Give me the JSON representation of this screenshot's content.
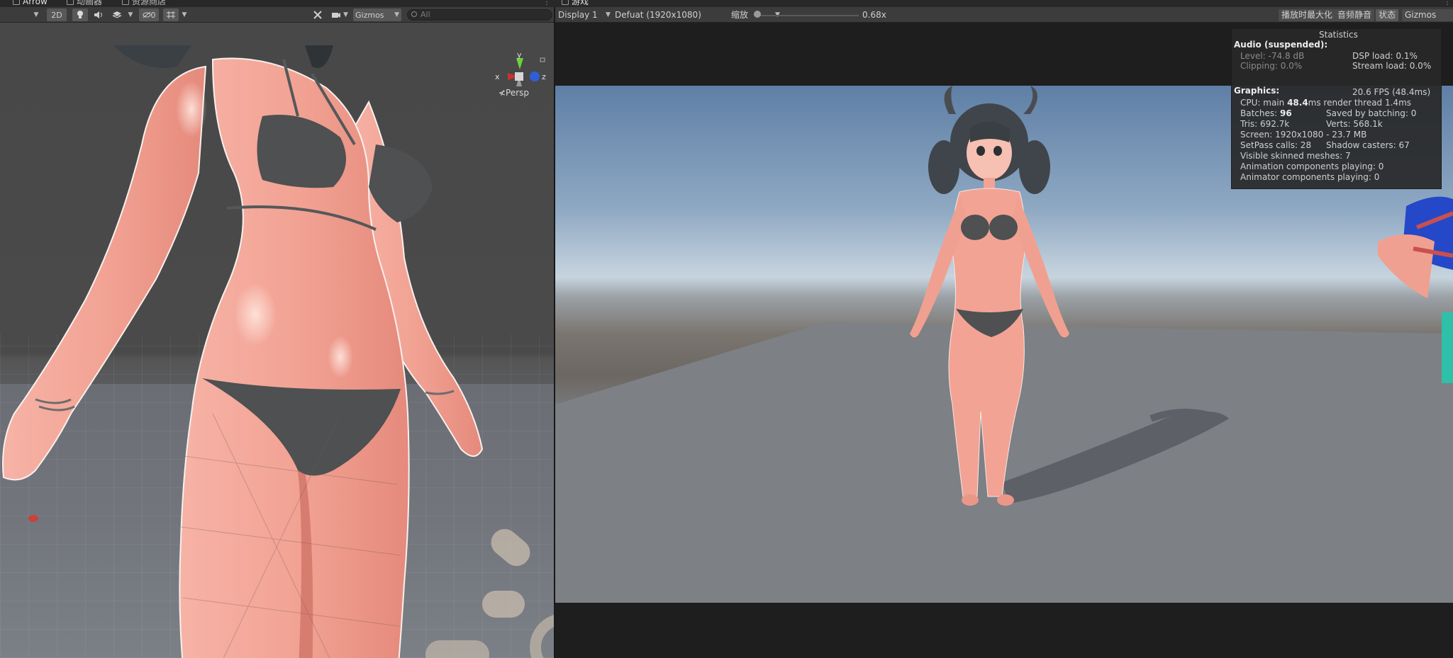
{
  "tabs": {
    "scene_tab_arrow": "Arrow",
    "animator_tab": "动画器",
    "asset_store_tab": "资源商店",
    "game_tab": "游戏"
  },
  "scene_toolbar": {
    "mode_2d": "2D",
    "hidden_count": "0",
    "gizmos_label": "Gizmos",
    "search_placeholder": "All"
  },
  "scene_view": {
    "axis_x": "x",
    "axis_y": "y",
    "axis_z": "z",
    "persp_label": "≮Persp"
  },
  "game_toolbar": {
    "display": "Display 1",
    "resolution": "Defuat (1920x1080)",
    "scale_label": "缩放",
    "scale_value": "0.68x",
    "maximize_on_play": "播放时最大化",
    "mute_audio": "音频静音",
    "stats_button": "状态",
    "gizmos_label": "Gizmos"
  },
  "statistics": {
    "title": "Statistics",
    "audio_header": "Audio (suspended):",
    "level": "Level: -74.8 dB",
    "clipping": "Clipping: 0.0%",
    "dsp_load": "DSP load: 0.1%",
    "stream_load": "Stream load: 0.0%",
    "graphics_header": "Graphics:",
    "fps": "20.6 FPS (48.4ms)",
    "cpu_prefix": "CPU: main ",
    "cpu_main": "48.4",
    "cpu_suffix": "ms  render thread 1.4ms",
    "batches_prefix": "Batches: ",
    "batches": "96",
    "saved_by_batching": "Saved by batching: 0",
    "tris": "Tris: 692.7k",
    "verts": "Verts: 568.1k",
    "screen": "Screen: 1920x1080 - 23.7 MB",
    "setpass": "SetPass calls: 28",
    "shadow_casters": "Shadow casters: 67",
    "visible_skinned": "Visible skinned meshes: 7",
    "animation_components": "Animation components playing: 0",
    "animator_components": "Animator components playing: 0"
  },
  "colors": {
    "toolbar_bg": "#3c3c3c",
    "panel_bg": "#282828",
    "skin": "#f2a394",
    "bikini": "#4e5052",
    "hair": "#3f454a",
    "axis_x": "#c8322f",
    "axis_y": "#6ed23c",
    "axis_z": "#2f5fd8"
  }
}
